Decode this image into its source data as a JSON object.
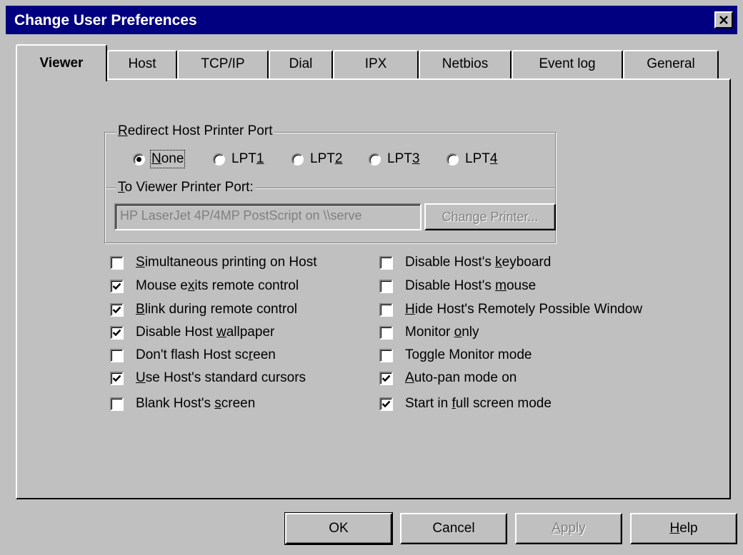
{
  "window": {
    "title": "Change User Preferences",
    "close_icon": "close-icon"
  },
  "tabs": [
    {
      "label": "Viewer",
      "active": true
    },
    {
      "label": "Host",
      "active": false
    },
    {
      "label": "TCP/IP",
      "active": false
    },
    {
      "label": "Dial",
      "active": false
    },
    {
      "label": "IPX",
      "active": false
    },
    {
      "label": "Netbios",
      "active": false
    },
    {
      "label": "Event log",
      "active": false
    },
    {
      "label": "General",
      "active": false
    }
  ],
  "redirect": {
    "group_label_mnemonic": "R",
    "group_label_rest": "edirect Host Printer Port",
    "selected": "None",
    "options": [
      {
        "pre": "",
        "mn": "N",
        "post": "one"
      },
      {
        "pre": "LPT",
        "mn": "1",
        "post": ""
      },
      {
        "pre": "LPT",
        "mn": "2",
        "post": ""
      },
      {
        "pre": "LPT",
        "mn": "3",
        "post": ""
      },
      {
        "pre": "LPT",
        "mn": "4",
        "post": ""
      }
    ],
    "viewer_label_mnemonic": "T",
    "viewer_label_rest": "o Viewer Printer Port:",
    "printer_value": "HP LaserJet 4P/4MP PostScript on \\\\serve",
    "change_printer_label": "Change Printer..."
  },
  "options_left": [
    {
      "pre": "",
      "mn": "S",
      "post": "imultaneous printing on Host",
      "checked": false
    },
    {
      "pre": "Mouse e",
      "mn": "x",
      "post": "its remote control",
      "checked": true
    },
    {
      "pre": "",
      "mn": "B",
      "post": "link during remote control",
      "checked": true
    },
    {
      "pre": "Disable Host ",
      "mn": "w",
      "post": "allpaper",
      "checked": true
    },
    {
      "pre": "Don't flash Host sc",
      "mn": "r",
      "post": "een",
      "checked": false
    },
    {
      "pre": "",
      "mn": "U",
      "post": "se Host's standard cursors",
      "checked": true
    },
    {
      "pre": "Blank Host's ",
      "mn": "s",
      "post": "creen",
      "checked": false
    }
  ],
  "options_right": [
    {
      "pre": "Disable Host's ",
      "mn": "k",
      "post": "eyboard",
      "checked": false
    },
    {
      "pre": "Disable Host's ",
      "mn": "m",
      "post": "ouse",
      "checked": false
    },
    {
      "pre": "",
      "mn": "H",
      "post": "ide Host's Remotely Possible Window",
      "checked": false
    },
    {
      "pre": "Monitor ",
      "mn": "o",
      "post": "nly",
      "checked": false
    },
    {
      "pre": "To",
      "mn": "g",
      "post": "gle Monitor mode",
      "checked": false
    },
    {
      "pre": "",
      "mn": "A",
      "post": "uto-pan mode on",
      "checked": true
    },
    {
      "pre": "Start in ",
      "mn": "f",
      "post": "ull screen mode",
      "checked": true
    }
  ],
  "buttons": {
    "ok": "OK",
    "cancel": "Cancel",
    "apply_mnemonic": "A",
    "apply_rest": "pply",
    "help_mnemonic": "H",
    "help_rest": "elp"
  }
}
